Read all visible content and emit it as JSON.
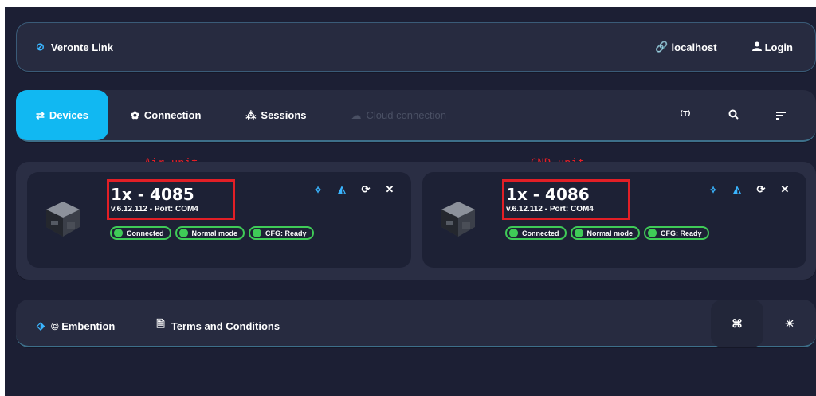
{
  "app": {
    "name": "Veronte Link"
  },
  "topbar": {
    "host_label": "localhost",
    "login_label": "Login"
  },
  "nav": {
    "tabs": [
      {
        "label": "Devices",
        "icon": "swap-arrows-icon",
        "active": true
      },
      {
        "label": "Connection",
        "icon": "gear-icon"
      },
      {
        "label": "Sessions",
        "icon": "sessions-icon"
      },
      {
        "label": "Cloud connection",
        "icon": "cloud-icon",
        "disabled": true
      }
    ],
    "right_icons": [
      "antenna-icon",
      "search-icon",
      "sort-icon"
    ]
  },
  "annotations": {
    "air_label": "Air unit",
    "gnd_label": "GND unit",
    "highlight_color": "#e21f26"
  },
  "devices": [
    {
      "title": "1x - 4085",
      "subtitle": "v.6.12.112 - Port: COM4",
      "badges": [
        "Connected",
        "Normal mode",
        "CFG: Ready"
      ]
    },
    {
      "title": "1x - 4086",
      "subtitle": "v.6.12.112 - Port: COM4",
      "badges": [
        "Connected",
        "Normal mode",
        "CFG: Ready"
      ]
    }
  ],
  "footer": {
    "copyright": "© Embention",
    "terms": "Terms and Conditions"
  },
  "colors": {
    "accent": "#11b8f2",
    "status_ok": "#3fcb57",
    "background": "#1c1f34"
  }
}
